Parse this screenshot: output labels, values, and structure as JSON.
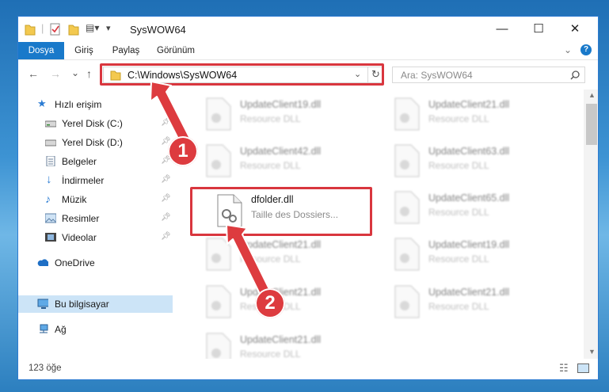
{
  "window": {
    "title": "SysWOW64",
    "controls": {
      "minimize": "—",
      "maximize": "☐",
      "close": "✕"
    }
  },
  "ribbon": {
    "tabs": [
      {
        "label": "Dosya",
        "active": true
      },
      {
        "label": "Giriş"
      },
      {
        "label": "Paylaş"
      },
      {
        "label": "Görünüm"
      }
    ],
    "expand_icon": "chevron-down-icon",
    "help_icon": "?"
  },
  "nav": {
    "back": "←",
    "forward": "→",
    "recent": "⌄",
    "up": "↑",
    "address": "C:\\Windows\\SysWOW64",
    "search_placeholder": "Ara: SysWOW64"
  },
  "sidebar": {
    "items": [
      {
        "label": "Hızlı erişim",
        "icon": "star-icon"
      },
      {
        "label": "Yerel Disk (C:)",
        "icon": "drive-icon",
        "pinned": true
      },
      {
        "label": "Yerel Disk (D:)",
        "icon": "drive-icon",
        "pinned": true
      },
      {
        "label": "Belgeler",
        "icon": "documents-icon",
        "pinned": true
      },
      {
        "label": "İndirmeler",
        "icon": "download-icon",
        "pinned": true
      },
      {
        "label": "Müzik",
        "icon": "music-icon",
        "pinned": true
      },
      {
        "label": "Resimler",
        "icon": "pictures-icon",
        "pinned": true
      },
      {
        "label": "Videolar",
        "icon": "videos-icon",
        "pinned": true
      },
      {
        "label": "OneDrive",
        "icon": "cloud-icon"
      },
      {
        "label": "Bu bilgisayar",
        "icon": "computer-icon",
        "selected": true
      },
      {
        "label": "Ağ",
        "icon": "network-icon"
      }
    ]
  },
  "files": {
    "highlighted": {
      "name": "dfolder.dll",
      "desc": "Taille des Dossiers..."
    },
    "blurred": [
      {
        "name": "UpdateClient19.dll",
        "desc": "Resource DLL"
      },
      {
        "name": "UpdateClient21.dll",
        "desc": "Resource DLL"
      },
      {
        "name": "UpdateClient42.dll",
        "desc": "Resource DLL"
      },
      {
        "name": "UpdateClient63.dll",
        "desc": "Resource DLL"
      },
      {
        "name": "UpdateClient65.dll",
        "desc": "Resource DLL"
      },
      {
        "name": "UpdateClient21.dll",
        "desc": "Resource DLL"
      },
      {
        "name": "UpdateClient19.dll",
        "desc": "Resource DLL"
      },
      {
        "name": "UpdateClient21.dll",
        "desc": "Resource DLL"
      },
      {
        "name": "UpdateClient21.dll",
        "desc": "Resource DLL"
      },
      {
        "name": "UpdateClient21.dll",
        "desc": "Resource DLL"
      }
    ]
  },
  "status": {
    "count": "123 öğe"
  },
  "annotations": {
    "step1": "1",
    "step2": "2",
    "color": "#dd3b3f"
  }
}
